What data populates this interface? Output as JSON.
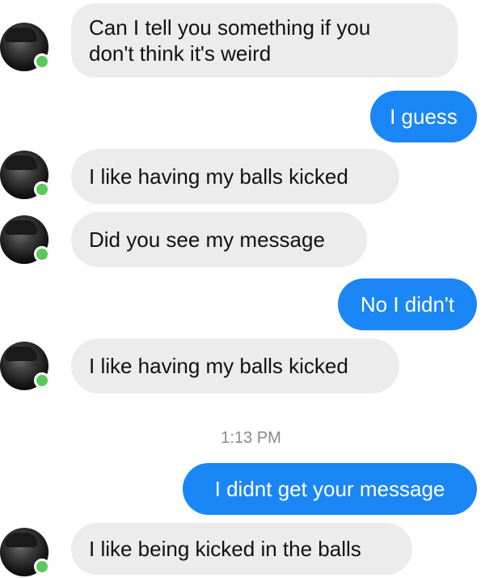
{
  "messages": [
    {
      "sender": "them",
      "text_line1": "Can I tell you something if you",
      "text_line2": "don't think it's weird"
    },
    {
      "sender": "me",
      "text": "I guess"
    },
    {
      "sender": "them",
      "text": "I like having my balls kicked"
    },
    {
      "sender": "them",
      "text": "Did you see my message"
    },
    {
      "sender": "me",
      "text": "No I didn't"
    },
    {
      "sender": "them",
      "text": "I like having my balls kicked"
    },
    {
      "sender": "me",
      "text": "I didnt get your message"
    },
    {
      "sender": "them",
      "text": "I like being kicked in the balls"
    }
  ],
  "timestamp": "1:13 PM",
  "colors": {
    "outgoing_bubble": "#1b86f5",
    "incoming_bubble": "#ececec",
    "presence_dot": "#5ac85a"
  },
  "icons": {
    "avatar": "contact-avatar",
    "presence": "online-status-dot"
  }
}
